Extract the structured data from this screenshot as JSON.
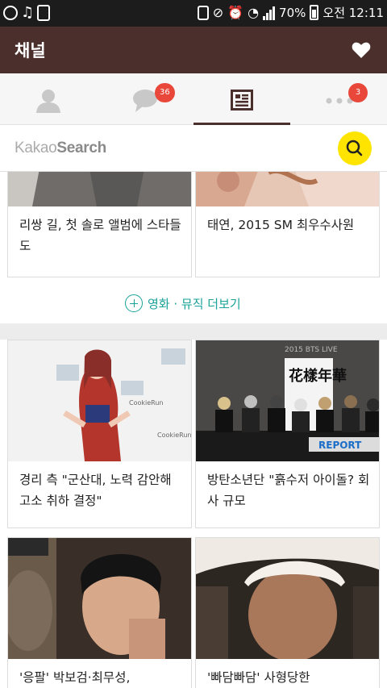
{
  "status_bar": {
    "battery_percent": "70%",
    "time": "오전 12:11"
  },
  "app_bar": {
    "title": "채널"
  },
  "tabs": [
    {
      "name": "friends",
      "badge": ""
    },
    {
      "name": "chats",
      "badge": "36"
    },
    {
      "name": "channel",
      "badge": ""
    },
    {
      "name": "more",
      "badge": "3"
    }
  ],
  "search": {
    "logo_light": "Kakao",
    "logo_bold": "Search"
  },
  "cards_top": [
    {
      "caption": "리쌍 길, 첫 솔로 앨범에 스타들도"
    },
    {
      "caption": "태연, 2015 SM 최우수사원"
    }
  ],
  "more_link": {
    "label": "영화 · 뮤직 더보기"
  },
  "cards_mid": [
    {
      "caption": "경리 측 \"군산대, 노력 감안해 고소 취하 결정\"",
      "thumb_overlay": ""
    },
    {
      "caption": "방탄소년단 \"흙수저 아이돌? 회사 규모",
      "thumb_overlay": "REPORT",
      "thumb_sign": "花樣年華",
      "thumb_top": "2015 BTS LIVE"
    }
  ],
  "cards_bottom": [
    {
      "caption": "'응팔' 박보검·최무성,"
    },
    {
      "caption": "'빠담빠담' 사형당한"
    }
  ],
  "colors": {
    "brand_brown": "#4a2f2c",
    "badge_red": "#e8473a",
    "search_yellow": "#ffe400",
    "link_teal": "#1aa29a"
  }
}
